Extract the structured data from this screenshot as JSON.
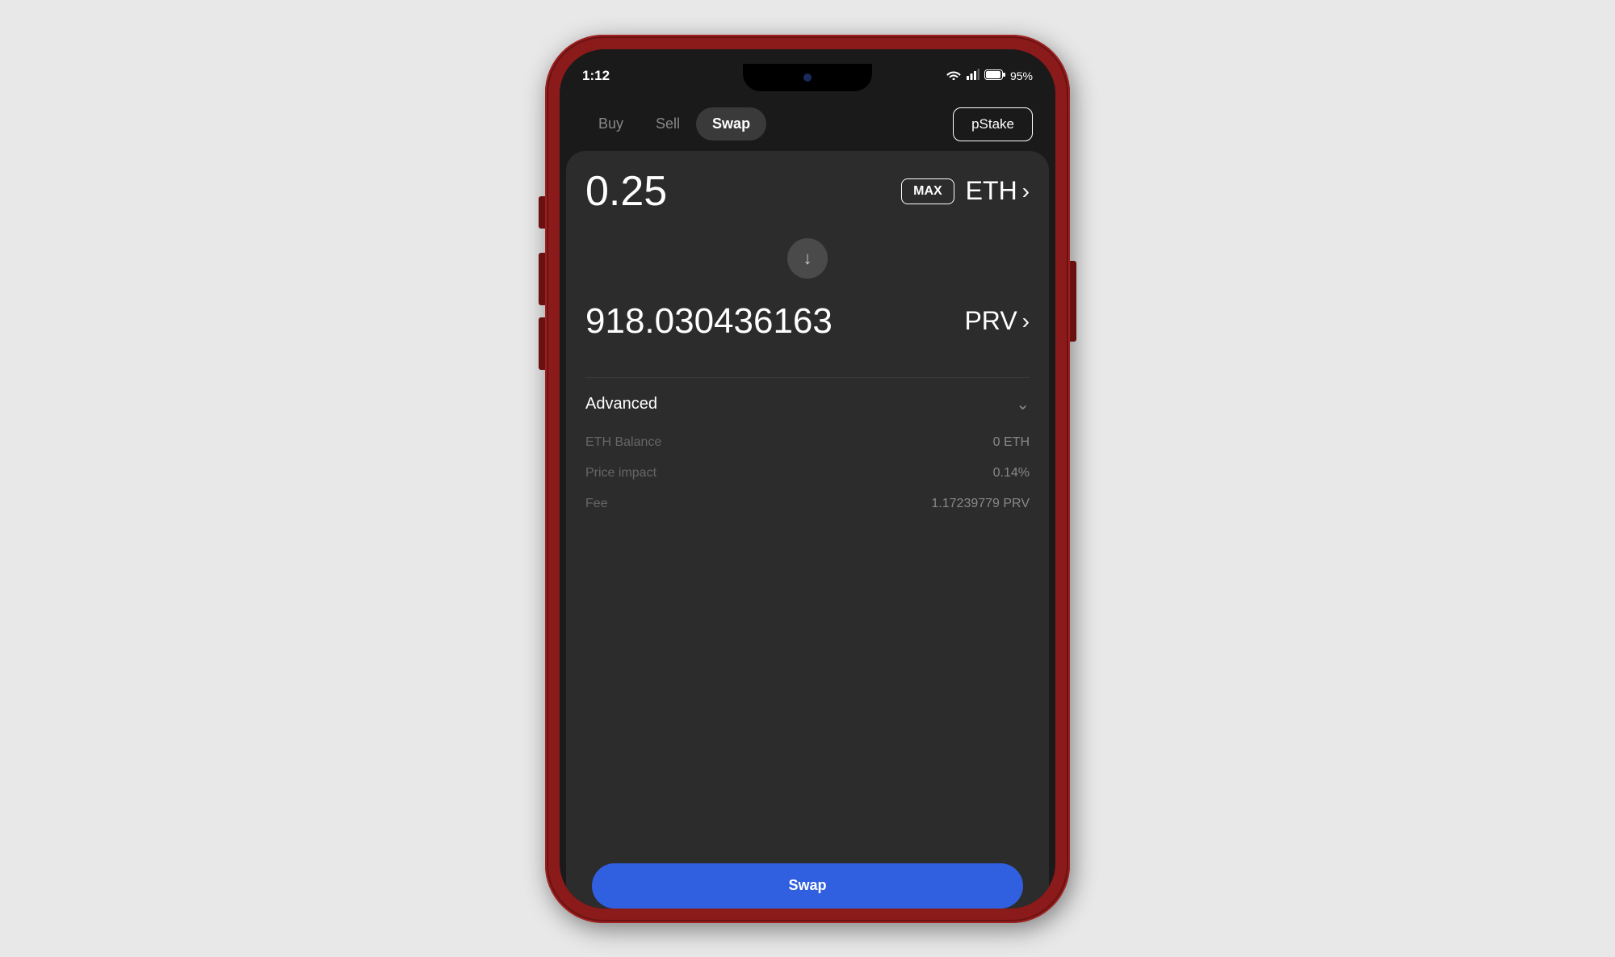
{
  "statusBar": {
    "time": "1:12",
    "battery": "95%",
    "batteryLabel": "95%"
  },
  "nav": {
    "buyLabel": "Buy",
    "sellLabel": "Sell",
    "swapLabel": "Swap",
    "pstakeLabel": "pStake",
    "activeTab": "swap"
  },
  "swap": {
    "fromAmount": "0.25",
    "maxLabel": "MAX",
    "fromToken": "ETH",
    "swapArrow": "↓",
    "toAmount": "918.030436163",
    "toToken": "PRV",
    "advancedLabel": "Advanced",
    "details": [
      {
        "label": "ETH Balance",
        "value": "0 ETH"
      },
      {
        "label": "Price impact",
        "value": "0.14%"
      },
      {
        "label": "Fee",
        "value": "1.17239779 PRV"
      }
    ],
    "submitLabel": "Swap"
  }
}
